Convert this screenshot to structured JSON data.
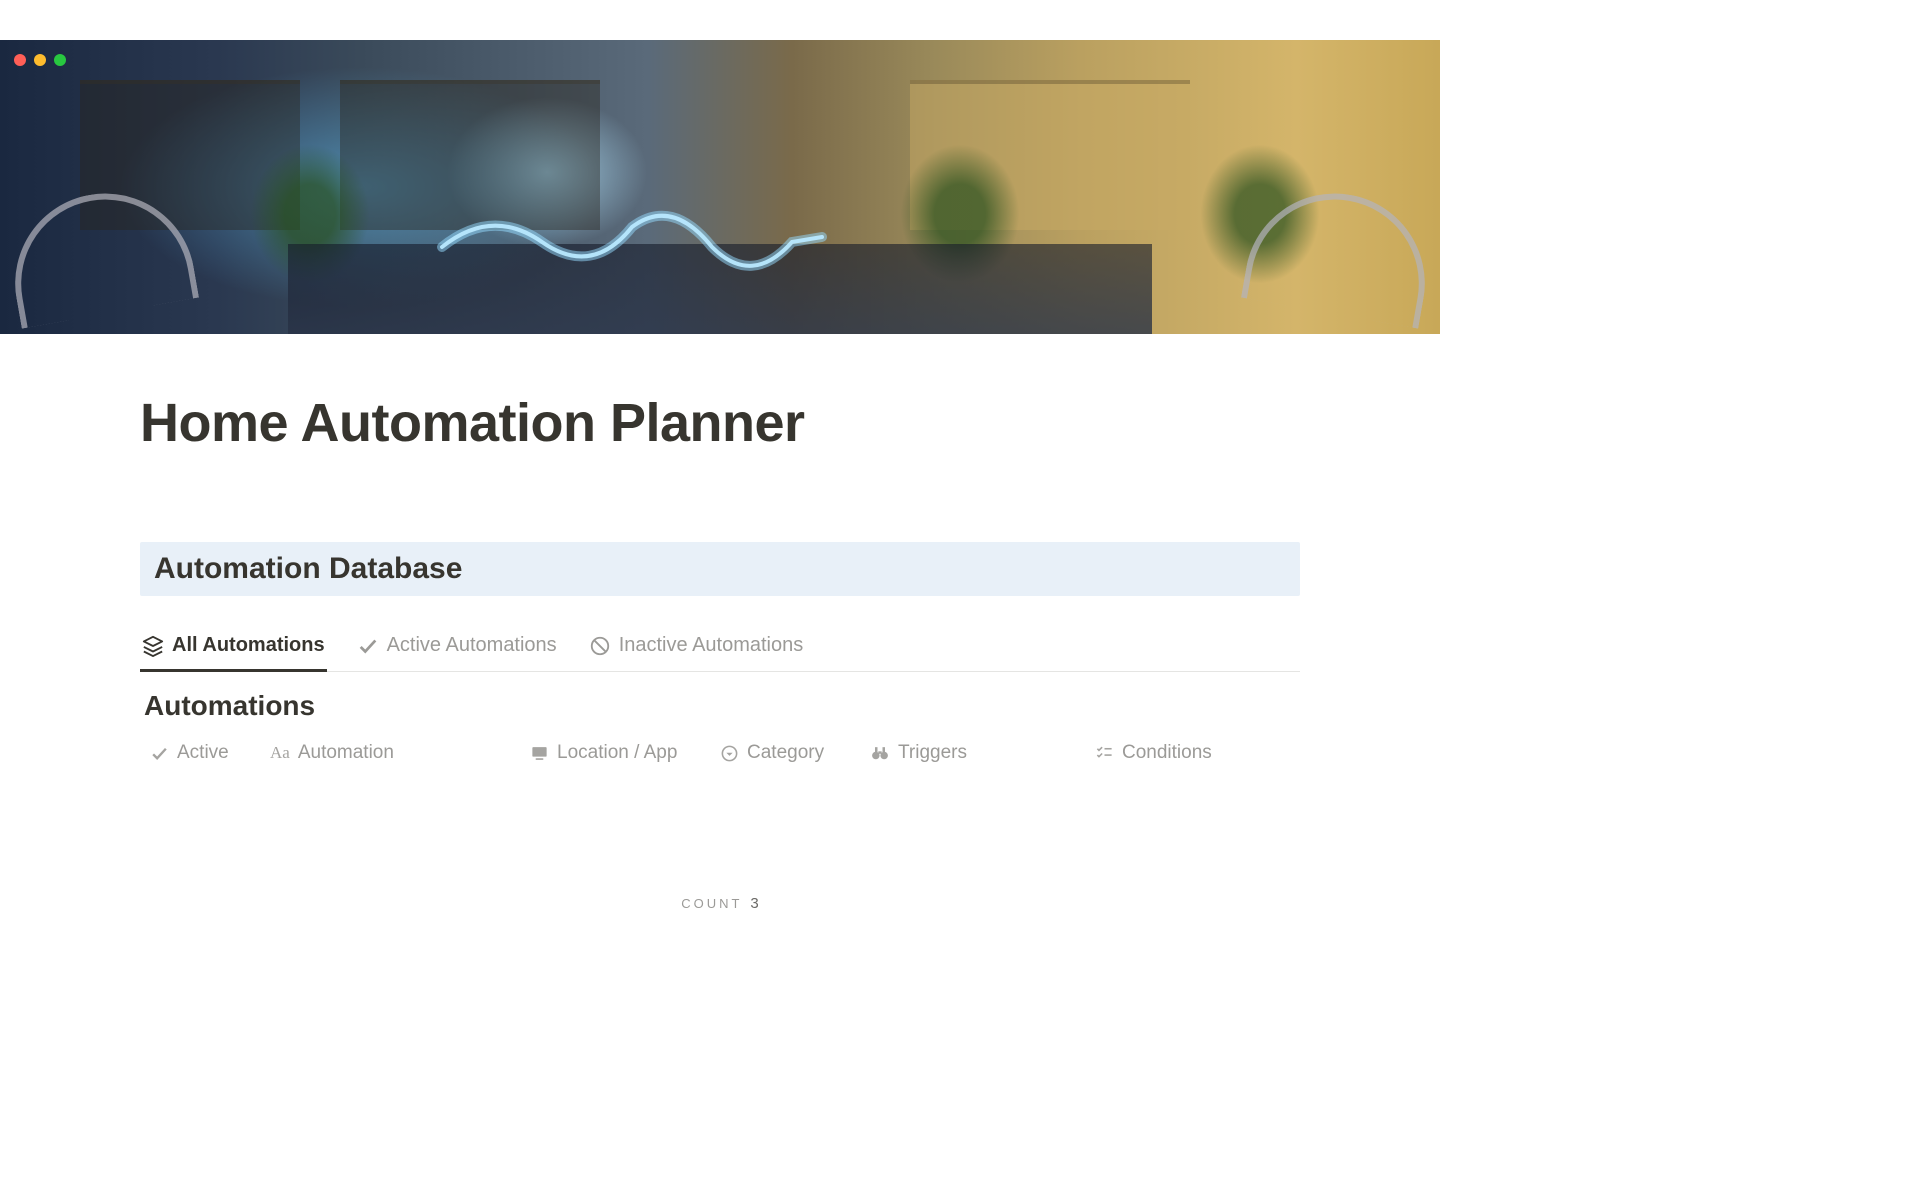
{
  "pageTitle": "Home Automation Planner",
  "sectionHeader": "Automation Database",
  "tabs": [
    {
      "label": "All Automations"
    },
    {
      "label": "Active Automations"
    },
    {
      "label": "Inactive Automations"
    }
  ],
  "dbTitle": "Automations",
  "columns": {
    "active": "Active",
    "automation": "Automation",
    "location": "Location / App",
    "category": "Category",
    "triggers": "Triggers",
    "conditions": "Conditions"
  },
  "footer": {
    "label": "COUNT",
    "count": "3"
  }
}
